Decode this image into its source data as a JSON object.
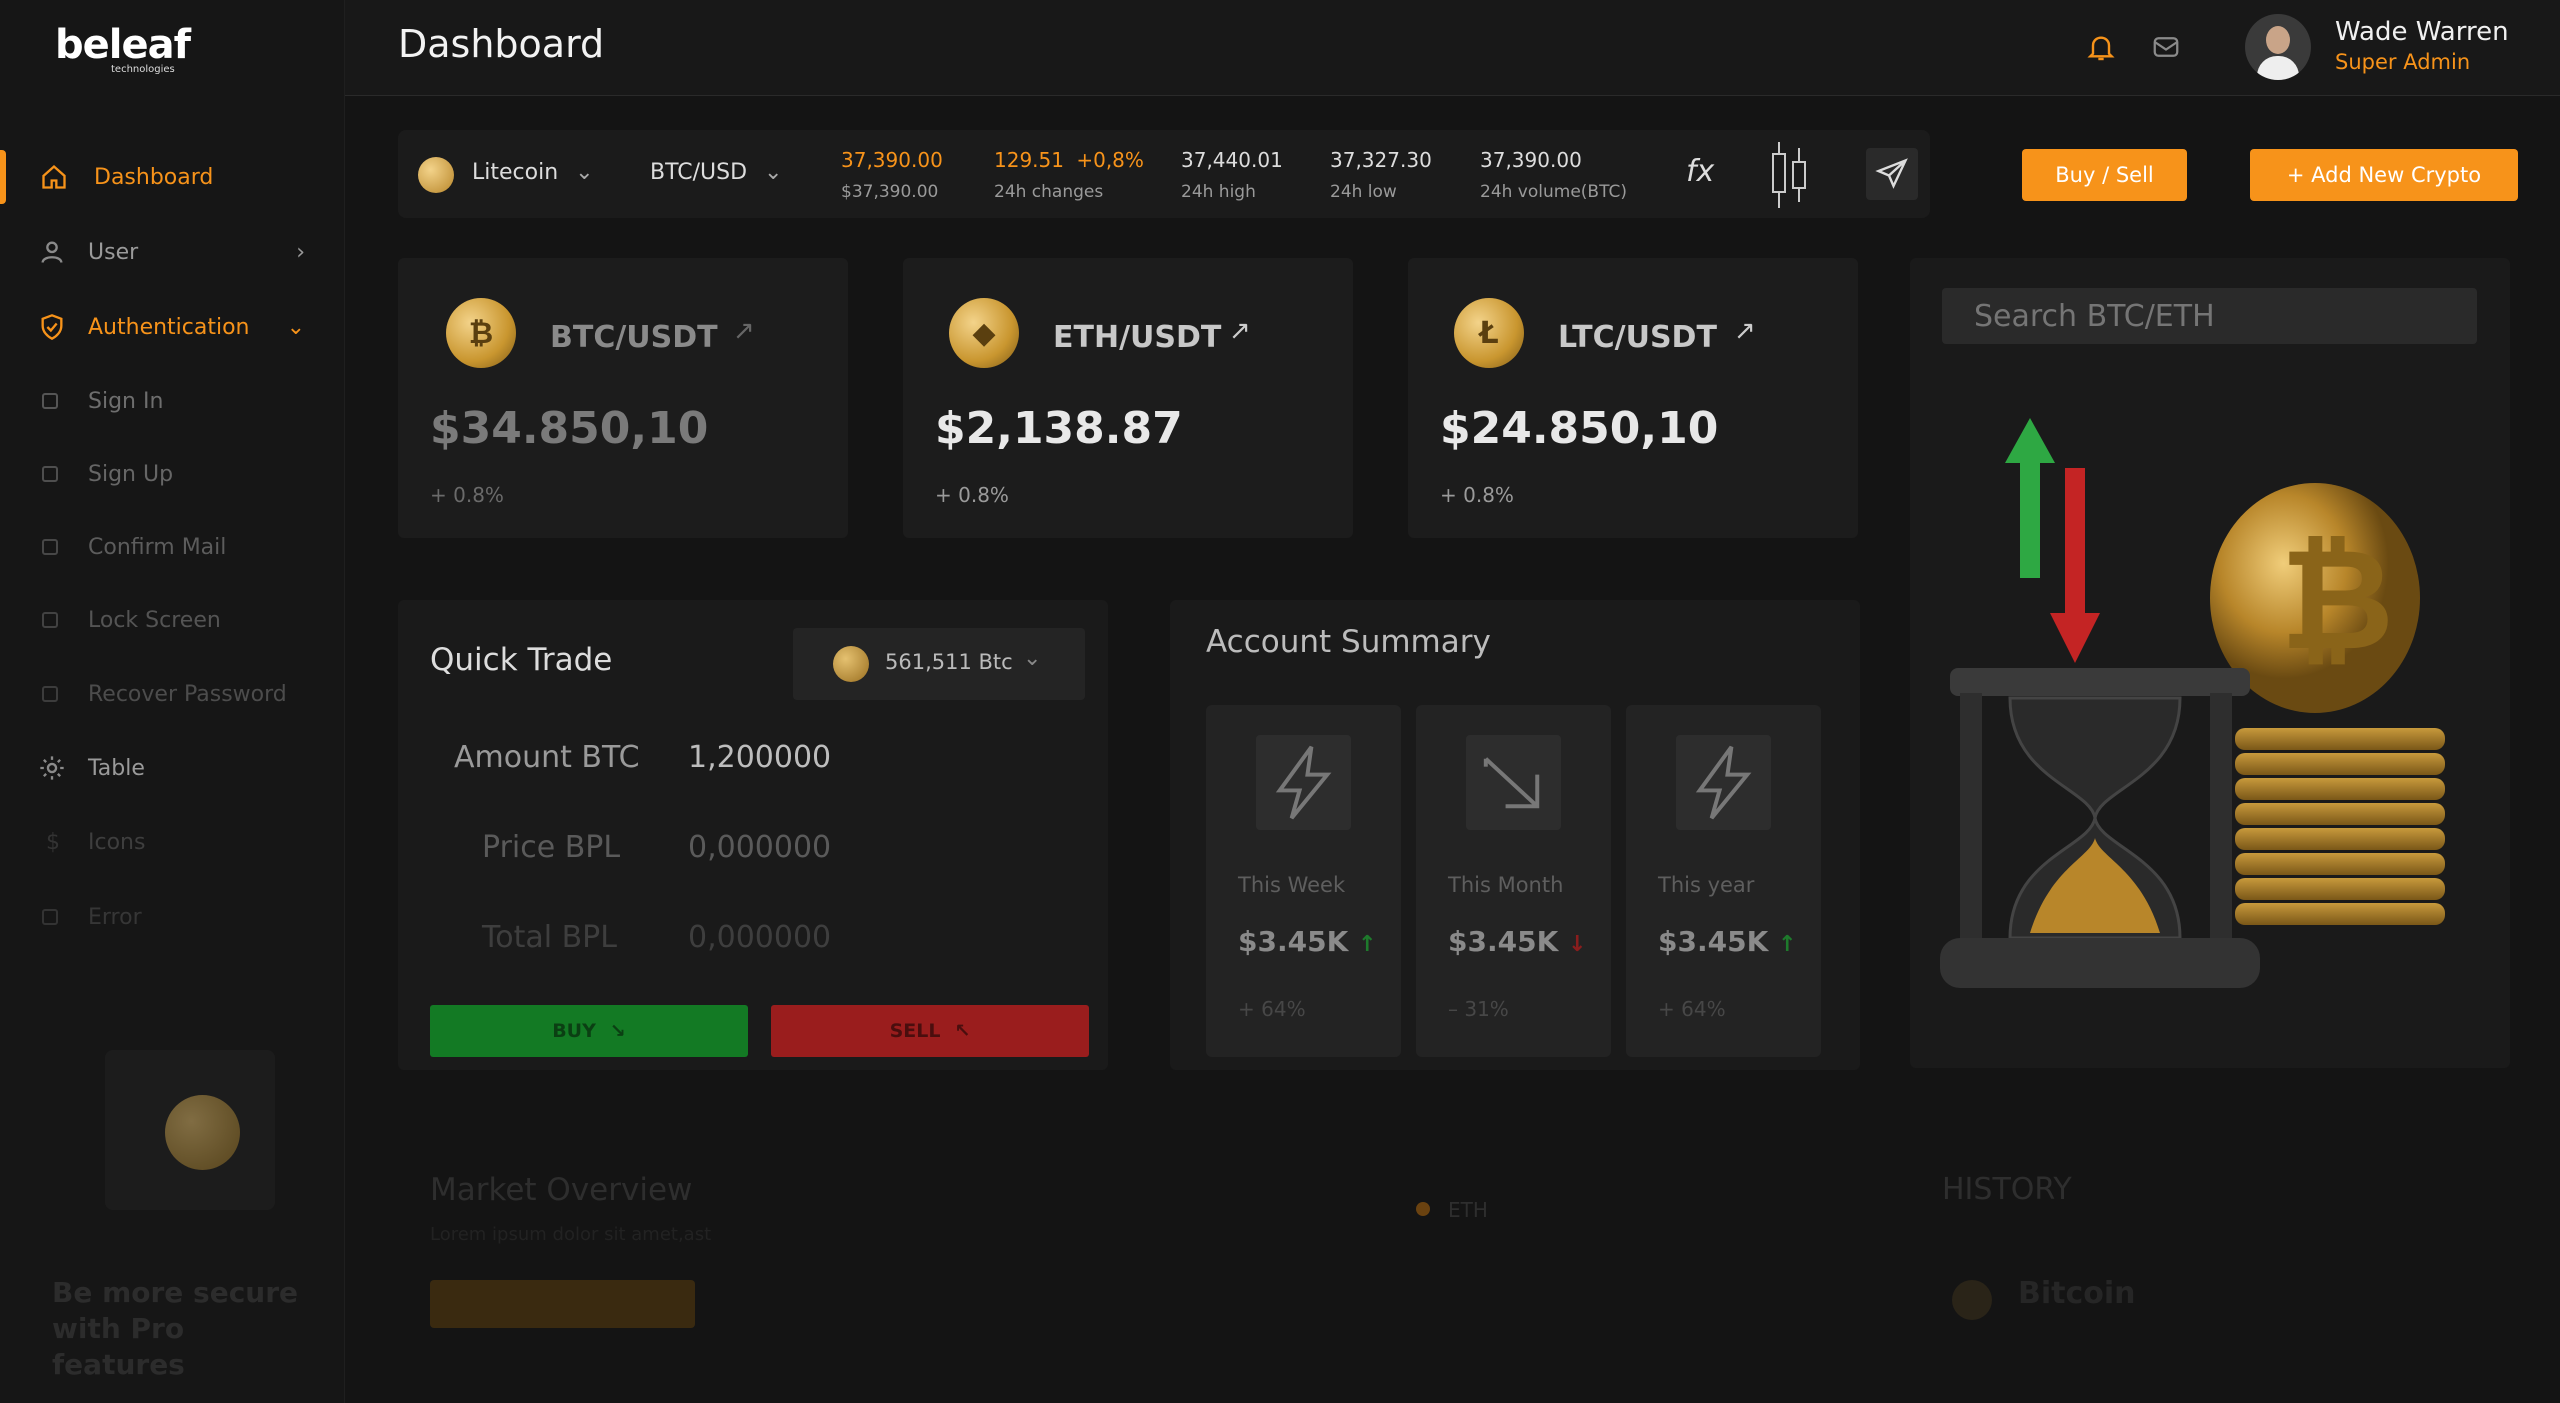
{
  "brand": {
    "logo": "beleaf",
    "sub": "technologies"
  },
  "header": {
    "title": "Dashboard",
    "user_name": "Wade Warren",
    "user_role": "Super Admin"
  },
  "sidebar": {
    "items": [
      {
        "label": "Dashboard"
      },
      {
        "label": "User"
      },
      {
        "label": "Authentication"
      },
      {
        "label": "Sign In"
      },
      {
        "label": "Sign Up"
      },
      {
        "label": "Confirm Mail"
      },
      {
        "label": "Lock Screen"
      },
      {
        "label": "Recover Password"
      },
      {
        "label": "Table"
      },
      {
        "label": "Icons"
      },
      {
        "label": "Error"
      }
    ],
    "promo": "Be more secure with Pro features"
  },
  "ticker": {
    "coin": "Litecoin",
    "pair": "BTC/USD",
    "last_price": "37,390.00",
    "last_price_sub": "$37,390.00",
    "change_value": "129.51",
    "change_pct": "+0,8%",
    "change_label": "24h changes",
    "high": "37,440.01",
    "high_label": "24h high",
    "low": "37,327.30",
    "low_label": "24h low",
    "volume": "37,390.00",
    "volume_label": "24h volume(BTC)",
    "fx": "fx",
    "buy_sell": "Buy / Sell",
    "add_new": "+ Add New Crypto"
  },
  "cards": [
    {
      "pair": "BTC/USDT",
      "price": "$34.850,10",
      "change": "+ 0.8%",
      "symbol": "₿"
    },
    {
      "pair": "ETH/USDT",
      "price": "$2,138.87",
      "change": "+ 0.8%",
      "symbol": "◆"
    },
    {
      "pair": "LTC/USDT",
      "price": "$24.850,10",
      "change": "+ 0.8%",
      "symbol": "Ł"
    }
  ],
  "search": {
    "placeholder": "Search BTC/ETH"
  },
  "quick_trade": {
    "title": "Quick Trade",
    "wallet": "561,511 Btc",
    "rows": [
      {
        "label": "Amount BTC",
        "value": "1,200000"
      },
      {
        "label": "Price BPL",
        "value": "0,000000"
      },
      {
        "label": "Total BPL",
        "value": "0,000000"
      }
    ],
    "buy": "BUY",
    "sell": "SELL"
  },
  "account_summary": {
    "title": "Account Summary",
    "items": [
      {
        "label": "This Week",
        "value": "$3.45K",
        "change": "+ 64%",
        "trend": "up"
      },
      {
        "label": "This Month",
        "value": "$3.45K",
        "change": "– 31%",
        "trend": "down"
      },
      {
        "label": "This year",
        "value": "$3.45K",
        "change": "+ 64%",
        "trend": "up"
      }
    ]
  },
  "market": {
    "title": "Market Overview",
    "subtitle": "Lorem ipsum dolor sit amet,ast",
    "legend": "ETH"
  },
  "history": {
    "title": "HISTORY",
    "row": "Bitcoin"
  },
  "colors": {
    "accent": "#f7931a",
    "buy": "#1e8a2e",
    "sell": "#b42020",
    "bg": "#141414"
  }
}
